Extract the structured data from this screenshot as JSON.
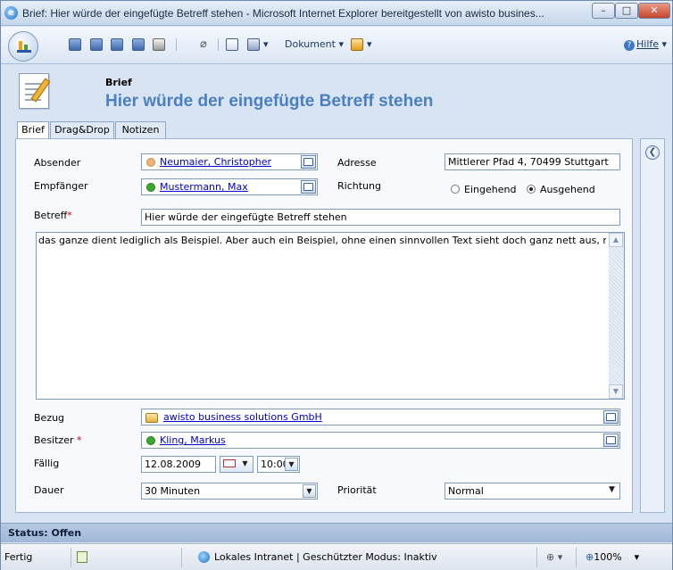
{
  "window": {
    "title": "Brief: Hier würde der eingefügte Betreff stehen - Microsoft Internet Explorer bereitgestellt von awisto busines...",
    "min": "–",
    "max": "□",
    "close": "✕"
  },
  "toolbar": {
    "dokument_label": "Dokument",
    "hilfe_label": "Hilfe"
  },
  "header": {
    "entity_type": "Brief",
    "title": "Hier würde der eingefügte Betreff stehen"
  },
  "tabs": [
    {
      "label": "Brief"
    },
    {
      "label": "Drag&Drop"
    },
    {
      "label": "Notizen"
    }
  ],
  "form": {
    "absender": {
      "label": "Absender",
      "value": "Neumaier, Christopher"
    },
    "empfaenger": {
      "label": "Empfänger",
      "value": "Mustermann, Max"
    },
    "adresse": {
      "label": "Adresse",
      "value": "Mittlerer Pfad 4, 70499 Stuttgart"
    },
    "richtung": {
      "label": "Richtung",
      "option_in": "Eingehend",
      "option_out": "Ausgehend",
      "selected": "Ausgehend"
    },
    "betreff": {
      "label": "Betreff",
      "required": "*",
      "value": "Hier würde der eingefügte Betreff stehen"
    },
    "beschreibung": "das ganze dient lediglich als Beispiel. Aber auch ein Beispiel, ohne einen sinnvollen Text sieht doch ganz nett aus, nicht wahr?",
    "bezug": {
      "label": "Bezug",
      "value": "awisto business solutions GmbH"
    },
    "besitzer": {
      "label": "Besitzer",
      "required": "*",
      "value": "Kling, Markus"
    },
    "faellig": {
      "label": "Fällig",
      "date": "12.08.2009",
      "time": "10:00"
    },
    "dauer": {
      "label": "Dauer",
      "value": "30 Minuten"
    },
    "prioritaet": {
      "label": "Priorität",
      "value": "Normal"
    }
  },
  "status": {
    "text": "Status: Offen"
  },
  "iebar": {
    "left": "Fertig",
    "zone": "Lokales Intranet | Geschützter Modus: Inaktiv",
    "zoom": "100%"
  },
  "colors": {
    "title_blue": "#4a7fc2",
    "link": "#0000cc",
    "required": "#d00000",
    "user_online": "#39a82b",
    "user_sender": "#f0b27a"
  }
}
